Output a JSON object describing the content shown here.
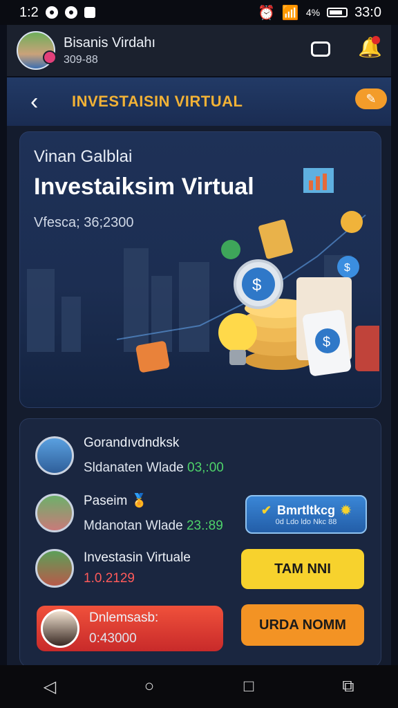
{
  "status_bar": {
    "time": "1:2",
    "right_text": "33:0",
    "signal_text": "4%"
  },
  "profile": {
    "name": "Bisanis Virdahı",
    "number": "309-88"
  },
  "titlebar": {
    "title": "INVESTAISIN VIRTUAL"
  },
  "hero": {
    "subtitle": "Vinan Galblai",
    "title": "Investaiksim Virtual",
    "value_text": "Vfesca; 36;2300"
  },
  "list": {
    "row1": {
      "name": "Gorandıvdndksk",
      "detail_label": "Sldanaten Wlade",
      "detail_value": "03,:00"
    },
    "row2": {
      "name": "Paseim",
      "detail_label": "Mdanotan Wlade",
      "detail_value": "23.:89"
    },
    "row3": {
      "name": "Investasin Virtuale",
      "detail_value": "1.0.2129"
    },
    "row4": {
      "name": "Dnlemsasb:",
      "detail_value": "0:43000"
    }
  },
  "buttons": {
    "blue": {
      "title": "Bmrtltkcg",
      "subtitle": "0d Ldo ldo Nkc 88"
    },
    "yellow": {
      "label": "TAM NNI"
    },
    "orange": {
      "label": "URDA NOMM"
    }
  },
  "colors": {
    "accent": "#f2b236",
    "yellow_btn": "#f7d22d",
    "orange_btn": "#f39324",
    "blue_btn": "#2c6fb9",
    "red_row": "#e0402f",
    "green_text": "#4ed36a"
  }
}
